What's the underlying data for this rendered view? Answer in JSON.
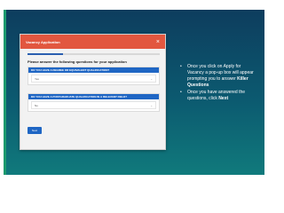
{
  "modal": {
    "title": "Vacancy Application",
    "close_symbol": "×",
    "progress_fraction": 0.27,
    "prompt": "Please answer the following questions for your application",
    "questions": [
      {
        "label": "DO YOU HAVE A DEGREE OR EQUIVALENT QUALIFICATION?",
        "value": "Yes"
      },
      {
        "label": "DO YOU HAVE A POSTGRADUATE QUALIFICATION IN A RELEVANT FIELD?",
        "value": "No"
      }
    ],
    "next_label": "Next"
  },
  "bullets": [
    {
      "text_before": "Once you click on Apply for Vacancy a pop-up box will appear prompting you to answer ",
      "bold": "Killer Questions",
      "text_after": ""
    },
    {
      "text_before": "Once you have answered the questions, click ",
      "bold": "Next",
      "text_after": ""
    }
  ],
  "colors": {
    "header": "#e2573f",
    "accent_blue": "#1f66c4",
    "background_dark": "#0d3d5e",
    "background_teal": "#107a7c"
  }
}
